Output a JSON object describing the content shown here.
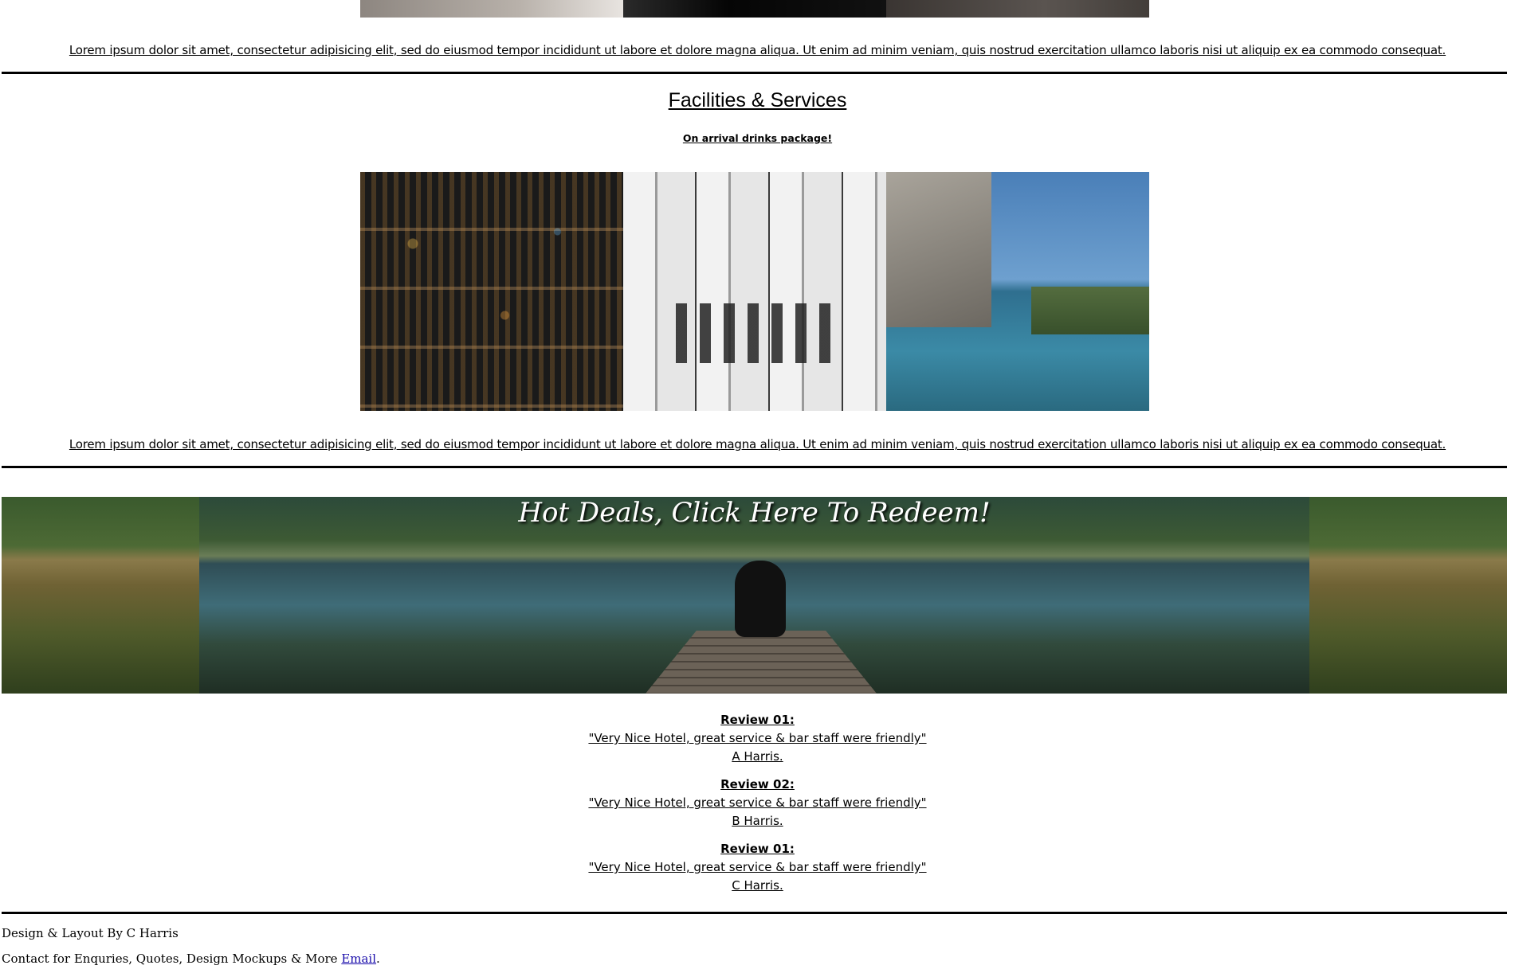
{
  "top_paragraph": "Lorem ipsum dolor sit amet, consectetur adipisicing elit, sed do eiusmod tempor incididunt ut labore et dolore magna aliqua. Ut enim ad minim veniam, quis nostrud exercitation ullamco laboris nisi ut aliquip ex ea commodo consequat.",
  "facilities": {
    "title": "Facilities & Services",
    "subtitle": "On arrival drinks package!",
    "paragraph": "Lorem ipsum dolor sit amet, consectetur adipisicing elit, sed do eiusmod tempor incididunt ut labore et dolore magna aliqua. Ut enim ad minim veniam, quis nostrud exercitation ullamco laboris nisi ut aliquip ex ea commodo consequat."
  },
  "banner": {
    "title": "Hot Deals, Click Here To Redeem!"
  },
  "reviews": [
    {
      "heading": "Review 01:",
      "quote": "\"Very Nice Hotel, great service & bar staff were friendly\"",
      "author": "A Harris."
    },
    {
      "heading": "Review 02:",
      "quote": "\"Very Nice Hotel, great service & bar staff were friendly\"",
      "author": "B Harris."
    },
    {
      "heading": "Review 01:",
      "quote": "\"Very Nice Hotel, great service & bar staff were friendly\"",
      "author": "C Harris."
    }
  ],
  "footer": {
    "credit": "Design & Layout By C Harris",
    "contact_prefix": "Contact for Enquries, Quotes, Design Mockups & More ",
    "email_link": "Email",
    "contact_suffix": "."
  }
}
